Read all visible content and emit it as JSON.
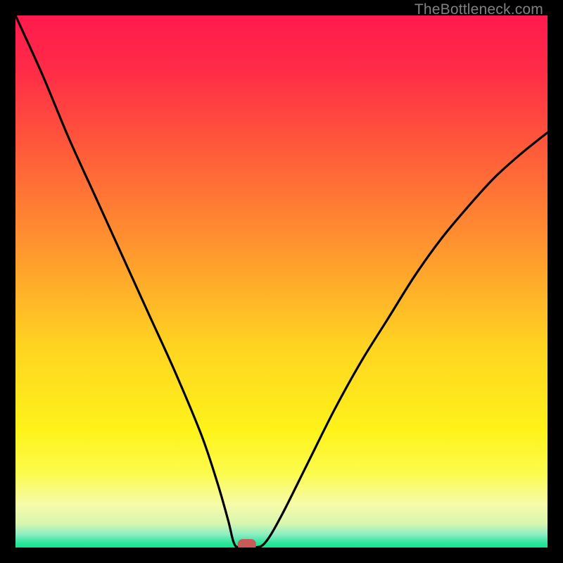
{
  "watermark": "TheBottleneck.com",
  "chart_data": {
    "type": "line",
    "title": "",
    "xlabel": "",
    "ylabel": "",
    "xlim": [
      0,
      100
    ],
    "ylim": [
      0,
      100
    ],
    "series": [
      {
        "name": "curve",
        "x": [
          0,
          5,
          10,
          15,
          20,
          25,
          30,
          35,
          38,
          40,
          41,
          42,
          45,
          47,
          50,
          55,
          60,
          65,
          70,
          75,
          80,
          85,
          90,
          95,
          100
        ],
        "values": [
          100,
          89,
          77,
          66,
          55,
          44,
          33,
          21,
          12,
          5,
          1,
          0,
          0,
          1,
          6,
          16,
          26,
          35,
          43,
          51,
          58,
          64,
          69.5,
          74,
          78
        ]
      }
    ],
    "marker": {
      "x": 43.5,
      "y": 0
    },
    "gradient_stops": [
      {
        "offset": 0.0,
        "color": "#ff1a4d"
      },
      {
        "offset": 0.1,
        "color": "#ff2b47"
      },
      {
        "offset": 0.25,
        "color": "#ff5a3a"
      },
      {
        "offset": 0.45,
        "color": "#ff9a2e"
      },
      {
        "offset": 0.62,
        "color": "#ffd321"
      },
      {
        "offset": 0.78,
        "color": "#fef31a"
      },
      {
        "offset": 0.86,
        "color": "#fbfb4d"
      },
      {
        "offset": 0.92,
        "color": "#f6fbaa"
      },
      {
        "offset": 0.955,
        "color": "#d8f6af"
      },
      {
        "offset": 0.975,
        "color": "#8eeec2"
      },
      {
        "offset": 0.99,
        "color": "#33e6a0"
      },
      {
        "offset": 1.0,
        "color": "#0fe58f"
      }
    ]
  }
}
